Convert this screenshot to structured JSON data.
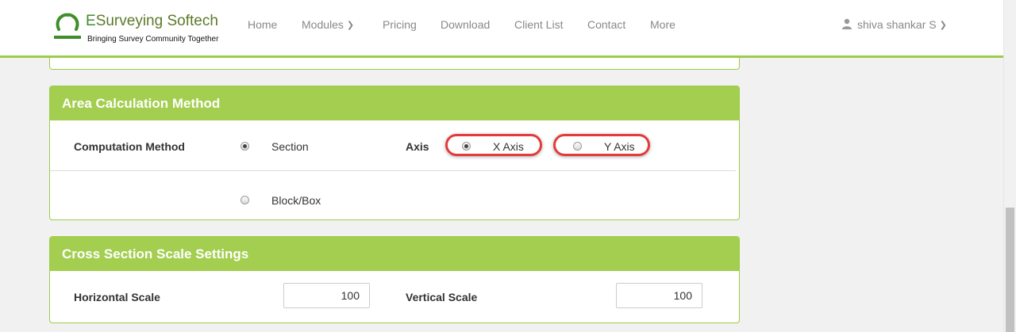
{
  "brand": {
    "name_first": "E",
    "name_rest": "Surveying Softech",
    "tagline": "Bringing Survey Community Together"
  },
  "nav": {
    "home": "Home",
    "modules": "Modules",
    "pricing": "Pricing",
    "download": "Download",
    "client_list": "Client List",
    "contact": "Contact",
    "more": "More"
  },
  "user": {
    "name": "shiva shankar S"
  },
  "area_calc": {
    "title": "Area Calculation Method",
    "computation_label": "Computation Method",
    "section_label": "Section",
    "block_label": "Block/Box",
    "axis_label": "Axis",
    "x_axis_label": "X Axis",
    "y_axis_label": "Y Axis",
    "selected_method": "Section",
    "selected_axis": "X Axis"
  },
  "scale": {
    "title": "Cross Section Scale Settings",
    "horizontal_label": "Horizontal Scale",
    "horizontal_value": "100",
    "vertical_label": "Vertical Scale",
    "vertical_value": "100"
  },
  "colors": {
    "brand_green": "#a3ce50",
    "highlight_red": "#e33b3b"
  }
}
